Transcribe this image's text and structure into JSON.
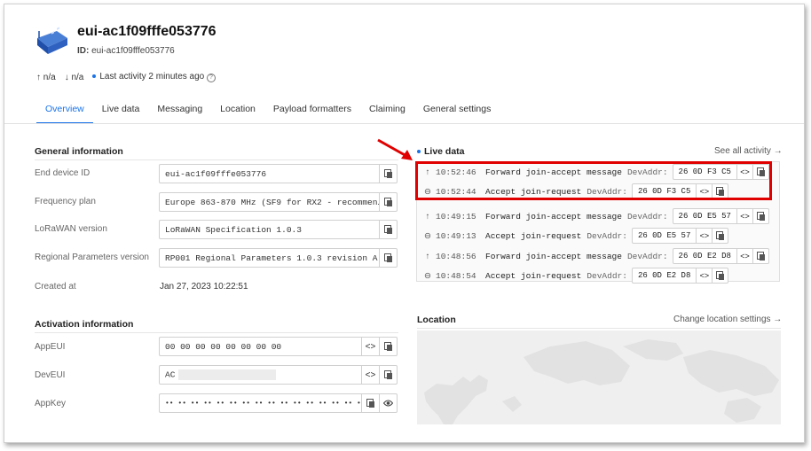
{
  "device": {
    "name": "eui-ac1f09fffe053776",
    "id_label": "ID:",
    "id_value": "eui-ac1f09fffe053776",
    "uplink": "n/a",
    "downlink": "n/a",
    "last_activity": "Last activity 2 minutes ago"
  },
  "tabs": [
    "Overview",
    "Live data",
    "Messaging",
    "Location",
    "Payload formatters",
    "Claiming",
    "General settings"
  ],
  "general": {
    "title": "General information",
    "fields": [
      {
        "label": "End device ID",
        "value": "eui-ac1f09fffe053776"
      },
      {
        "label": "Frequency plan",
        "value": "Europe 863-870 MHz (SF9 for RX2 - recommen…"
      },
      {
        "label": "LoRaWAN version",
        "value": "LoRaWAN Specification 1.0.3"
      },
      {
        "label": "Regional Parameters version",
        "value": "RP001 Regional Parameters 1.0.3 revision A"
      },
      {
        "label": "Created at",
        "value": "Jan 27, 2023 10:22:51"
      }
    ]
  },
  "activation": {
    "title": "Activation information",
    "fields": [
      {
        "label": "AppEUI",
        "value": "00 00 00 00 00 00 00 00"
      },
      {
        "label": "DevEUI",
        "value": "AC"
      },
      {
        "label": "AppKey",
        "value": "•• •• •• •• •• •• •• •• •• •• •• •• •• •• •• ••"
      }
    ]
  },
  "live": {
    "title": "Live data",
    "see_all": "See all activity →",
    "addr_label": "DevAddr:",
    "rows": [
      {
        "icon": "↑",
        "time": "10:52:46",
        "message": "Forward join-accept message",
        "addr": "26 0D F3 C5"
      },
      {
        "icon": "⊖",
        "time": "10:52:44",
        "message": "Accept join-request",
        "addr": "26 0D F3 C5"
      },
      {
        "icon": "↑",
        "time": "10:49:15",
        "message": "Forward join-accept message",
        "addr": "26 0D E5 57"
      },
      {
        "icon": "⊖",
        "time": "10:49:13",
        "message": "Accept join-request",
        "addr": "26 0D E5 57"
      },
      {
        "icon": "↑",
        "time": "10:48:56",
        "message": "Forward join-accept message",
        "addr": "26 0D E2 D8"
      },
      {
        "icon": "⊖",
        "time": "10:48:54",
        "message": "Accept join-request",
        "addr": "26 0D E2 D8"
      }
    ]
  },
  "location": {
    "title": "Location",
    "change_link": "Change location settings →"
  },
  "colors": {
    "accent": "#1a73e8",
    "highlight": "#e00000",
    "arrow": "#e00000"
  },
  "icons": {
    "device": "device-icon",
    "copy": "copy-icon",
    "swap": "swap-icon",
    "eye": "eye-icon"
  }
}
